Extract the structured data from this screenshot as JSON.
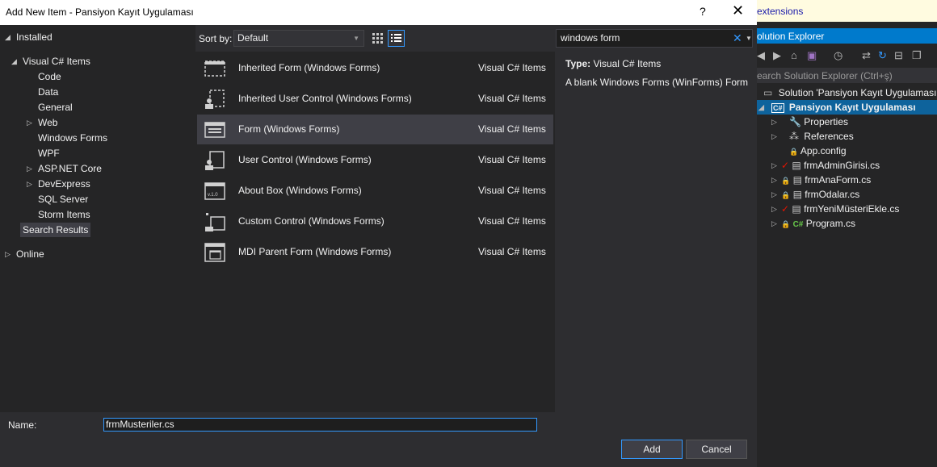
{
  "dialog": {
    "title": "Add New Item - Pansiyon Kayıt Uygulaması",
    "help": "?",
    "close": "✕"
  },
  "tree": {
    "installed": "Installed",
    "visual_csharp": "Visual C# Items",
    "children": [
      "Code",
      "Data",
      "General",
      "Web",
      "Windows Forms",
      "WPF",
      "ASP.NET Core",
      "DevExpress",
      "SQL Server",
      "Storm Items",
      "Search Results"
    ],
    "online": "Online"
  },
  "toolbar": {
    "sort_label": "Sort by:",
    "sort_value": "Default"
  },
  "items": [
    {
      "name": "Inherited Form (Windows Forms)",
      "category": "Visual C# Items"
    },
    {
      "name": "Inherited User Control (Windows Forms)",
      "category": "Visual C# Items"
    },
    {
      "name": "Form (Windows Forms)",
      "category": "Visual C# Items"
    },
    {
      "name": "User Control (Windows Forms)",
      "category": "Visual C# Items"
    },
    {
      "name": "About Box (Windows Forms)",
      "category": "Visual C# Items"
    },
    {
      "name": "Custom Control (Windows Forms)",
      "category": "Visual C# Items"
    },
    {
      "name": "MDI Parent Form (Windows Forms)",
      "category": "Visual C# Items"
    }
  ],
  "search": {
    "value": "windows form"
  },
  "details": {
    "type_label": "Type:",
    "type_value": "Visual C# Items",
    "description": "A blank Windows Forms (WinForms) Form"
  },
  "bottom": {
    "name_label": "Name:",
    "name_value": "frmMusteriler.cs",
    "add": "Add",
    "cancel": "Cancel"
  },
  "vs": {
    "extensions": "extensions",
    "se_title": "olution Explorer",
    "se_search": "earch Solution Explorer (Ctrl+ş)",
    "solution": "Solution 'Pansiyon Kayıt Uygulaması'",
    "project": "Pansiyon Kayıt Uygulaması",
    "nodes": [
      "Properties",
      "References",
      "App.config",
      "frmAdminGirisi.cs",
      "frmAnaForm.cs",
      "frmOdalar.cs",
      "frmYeniMüsteriEkle.cs",
      "Program.cs"
    ]
  },
  "colors": {
    "accent": "#3399ff",
    "selection": "#3f3f46",
    "se_selection": "#0e639c",
    "ext_bar": "#fffbe0"
  }
}
